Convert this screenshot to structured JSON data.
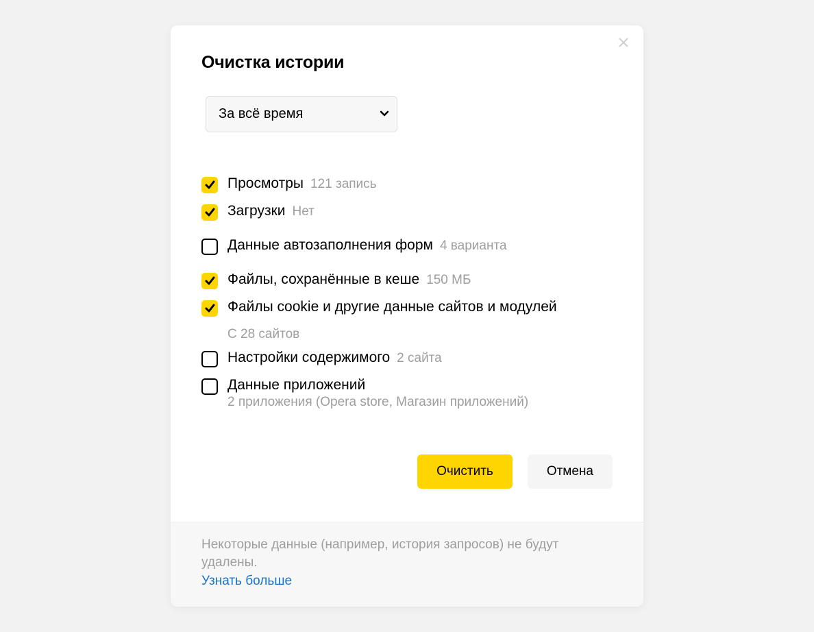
{
  "dialog": {
    "title": "Очистка истории",
    "time_range": "За всё время",
    "items": [
      {
        "label": "Просмотры",
        "sub": "121 запись"
      },
      {
        "label": "Загрузки",
        "sub": "Нет"
      },
      {
        "label": "Данные автозаполнения форм",
        "sub": "4 варианта"
      },
      {
        "label": "Файлы, сохранённые в кеше",
        "sub": "150 МБ"
      },
      {
        "label": "Файлы cookie и другие данные сайтов и модулей",
        "sub_block": "С 28 сайтов"
      },
      {
        "label": "Настройки содержимого",
        "sub": "2 сайта"
      },
      {
        "label": "Данные приложений",
        "sub_block": "2 приложения (Opera store, Магазин приложений)"
      }
    ],
    "buttons": {
      "clear": "Очистить",
      "cancel": "Отмена"
    },
    "footer": {
      "text": "Некоторые данные (например, история запросов) не будут удалены.",
      "link": "Узнать больше"
    }
  }
}
